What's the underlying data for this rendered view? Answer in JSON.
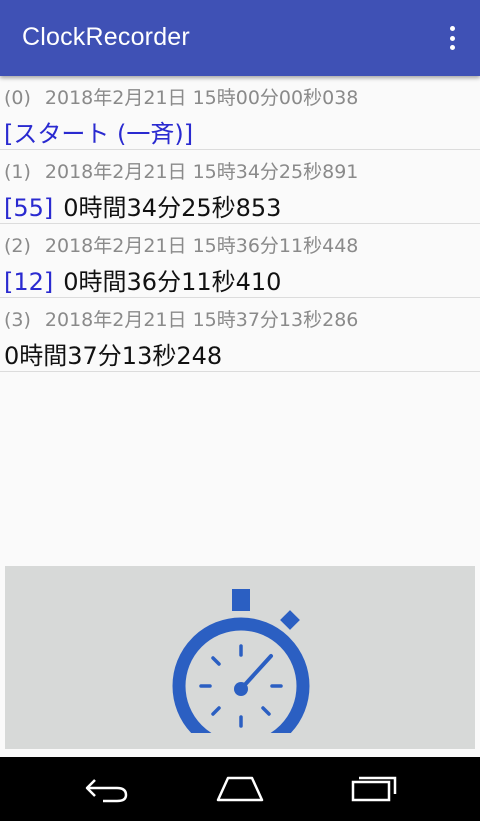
{
  "app": {
    "title": "ClockRecorder"
  },
  "entries": [
    {
      "index": "(0)",
      "timestamp": "2018年2月21日 15時00分00秒038",
      "tag": "",
      "value": "[スタート (一斉)]",
      "is_start": true
    },
    {
      "index": "(1)",
      "timestamp": "2018年2月21日 15時34分25秒891",
      "tag": "[55]",
      "value": "0時間34分25秒853",
      "is_start": false
    },
    {
      "index": "(2)",
      "timestamp": "2018年2月21日 15時36分11秒448",
      "tag": "[12]",
      "value": "0時間36分11秒410",
      "is_start": false
    },
    {
      "index": "(3)",
      "timestamp": "2018年2月21日 15時37分13秒286",
      "tag": "",
      "value": "0時間37分13秒248",
      "is_start": false
    }
  ],
  "icons": {
    "overflow": "more-vert-icon",
    "timer": "stopwatch-icon",
    "back": "back-icon",
    "home": "home-icon",
    "recents": "recents-icon"
  },
  "colors": {
    "appbar": "#3f51b5",
    "accent_text": "#2a2ad0",
    "timer_icon": "#2b5fc2",
    "timer_button_bg": "#d7d9d8"
  }
}
